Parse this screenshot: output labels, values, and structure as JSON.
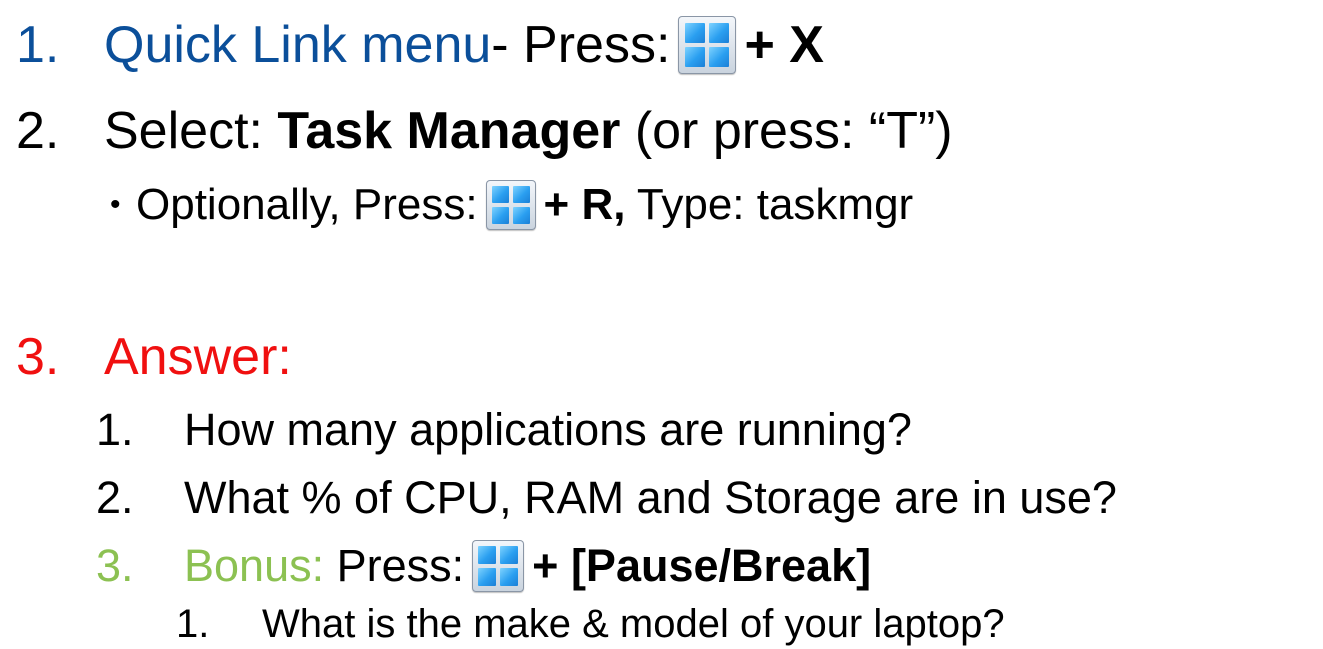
{
  "step1": {
    "number": "1.",
    "link_text": "Quick Link menu",
    "rest": " - Press:",
    "key_combo": "+ X",
    "win_icon": "windows-key-icon"
  },
  "step2": {
    "number": "2.",
    "prefix": "Select: ",
    "bold_text": "Task Manager",
    "suffix": " (or press: “T”)",
    "bullet": {
      "marker": "•",
      "prefix": "Optionally, Press:",
      "key_combo": "+ R,",
      "suffix": " Type: taskmgr",
      "win_icon": "windows-key-icon"
    }
  },
  "step3": {
    "number": "3.",
    "label": "Answer:",
    "questions": [
      {
        "number": "1.",
        "text": "How many applications are running?"
      },
      {
        "number": "2.",
        "text": "What % of CPU, RAM and Storage are in use?"
      }
    ],
    "bonus": {
      "number": "3.",
      "label": "Bonus:",
      "prefix": " Press:",
      "key_combo": "+ [Pause/Break]",
      "win_icon": "windows-key-icon",
      "sub_questions": [
        {
          "number": "1.",
          "text": "What is the make & model of your laptop?"
        }
      ]
    }
  },
  "colors": {
    "link_blue": "#0b4f9a",
    "answer_red": "#f01010",
    "bonus_green": "#8cc152",
    "text": "#000000"
  }
}
